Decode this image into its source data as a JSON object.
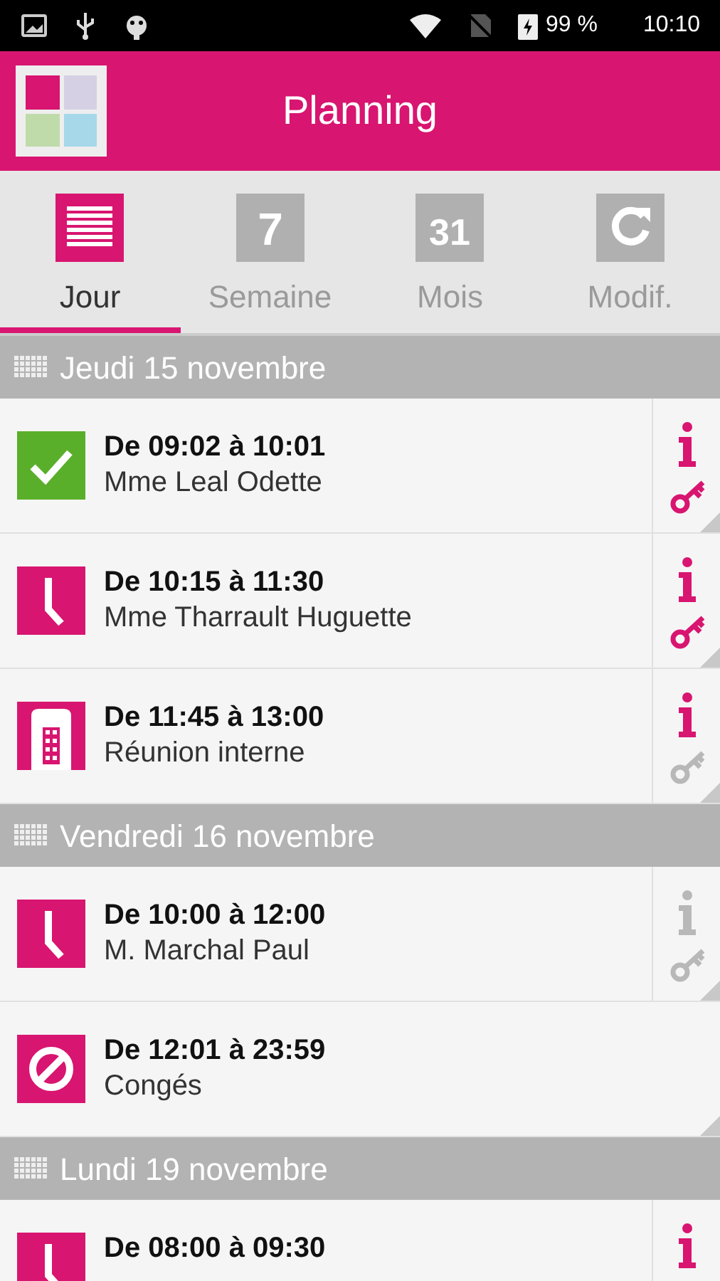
{
  "status_bar": {
    "battery": "99 %",
    "time": "10:10"
  },
  "header": {
    "title": "Planning"
  },
  "tabs": [
    {
      "label": "Jour",
      "kind": "list",
      "selected": true
    },
    {
      "label": "Semaine",
      "kind": "number",
      "icon_text": "7",
      "selected": false
    },
    {
      "label": "Mois",
      "kind": "number",
      "icon_text": "31",
      "selected": false
    },
    {
      "label": "Modif.",
      "kind": "refresh",
      "selected": false
    }
  ],
  "days": [
    {
      "title": "Jeudi 15 novembre",
      "entries": [
        {
          "kind": "done",
          "time": "De 09:02 à 10:01",
          "name": "Mme Leal Odette",
          "info_enabled": true,
          "key_enabled": true
        },
        {
          "kind": "clock",
          "time": "De 10:15 à 11:30",
          "name": "Mme Tharrault Huguette",
          "info_enabled": true,
          "key_enabled": true
        },
        {
          "kind": "building",
          "time": "De 11:45 à 13:00",
          "name": "Réunion interne",
          "info_enabled": true,
          "key_enabled": false
        }
      ]
    },
    {
      "title": "Vendredi 16 novembre",
      "entries": [
        {
          "kind": "clock",
          "time": "De 10:00 à 12:00",
          "name": "M. Marchal Paul",
          "info_enabled": false,
          "key_enabled": false
        },
        {
          "kind": "blocked",
          "time": "De 12:01 à 23:59",
          "name": "Congés"
        }
      ]
    },
    {
      "title": "Lundi 19 novembre",
      "entries": [
        {
          "kind": "clock",
          "time": "De 08:00 à 09:30",
          "info_enabled": true
        }
      ]
    }
  ]
}
